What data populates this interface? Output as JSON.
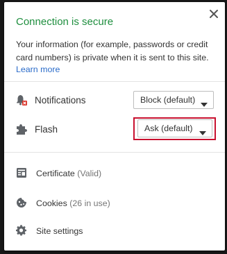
{
  "popup": {
    "title": "Connection is secure",
    "description": "Your information (for example, passwords or credit card numbers) is private when it is sent to this site.",
    "learn_more": "Learn more"
  },
  "permissions": [
    {
      "label": "Notifications",
      "icon": "notification-blocked-icon",
      "value": "Block (default)"
    },
    {
      "label": "Flash",
      "icon": "puzzle-piece-icon",
      "value": "Ask (default)"
    }
  ],
  "links": {
    "certificate": {
      "label": "Certificate",
      "detail": "(Valid)",
      "icon": "certificate-icon"
    },
    "cookies": {
      "label": "Cookies",
      "detail": "(26 in use)",
      "icon": "cookie-icon"
    },
    "site_settings": {
      "label": "Site settings",
      "icon": "gear-icon"
    }
  },
  "colors": {
    "secure_title": "#1e8e3e",
    "link": "#2a6bc9",
    "highlight_box": "#c8102e"
  }
}
